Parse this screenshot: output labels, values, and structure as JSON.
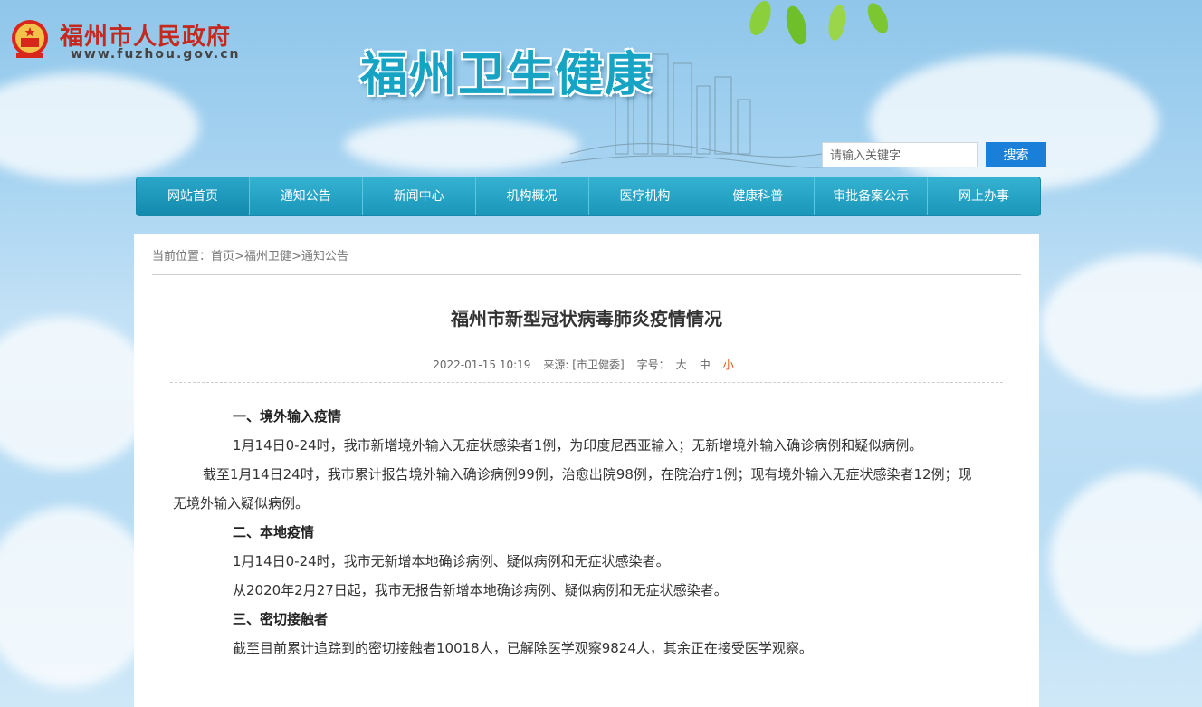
{
  "gov": {
    "name": "福州市人民政府",
    "url": "www.fuzhou.gov.cn"
  },
  "site_title": "福州卫生健康",
  "search": {
    "placeholder": "请输入关键字",
    "button_label": "搜索"
  },
  "nav": {
    "items": [
      {
        "label": "网站首页"
      },
      {
        "label": "通知公告"
      },
      {
        "label": "新闻中心"
      },
      {
        "label": "机构概况"
      },
      {
        "label": "医疗机构"
      },
      {
        "label": "健康科普"
      },
      {
        "label": "审批备案公示"
      },
      {
        "label": "网上办事"
      }
    ]
  },
  "breadcrumb": {
    "prefix": "当前位置：",
    "home": "首页",
    "sep1": ">",
    "level1": "福州卫健",
    "sep2": ">",
    "level2": "通知公告"
  },
  "article": {
    "title": "福州市新型冠状病毒肺炎疫情情况",
    "date": "2022-01-15 10:19",
    "source": "来源: [市卫健委]",
    "font_label": "字号：",
    "font_large": "大",
    "font_medium": "中",
    "font_small": "小",
    "sections": [
      {
        "heading": "一、境外输入疫情"
      },
      {
        "p": "1月14日0-24时，我市新增境外输入无症状感染者1例，为印度尼西亚输入；无新增境外输入确诊病例和疑似病例。"
      },
      {
        "p": "截至1月14日24时，我市累计报告境外输入确诊病例99例，治愈出院98例，在院治疗1例；现有境外输入无症状感染者12例；现无境外输入疑似病例。"
      },
      {
        "heading": "二、本地疫情"
      },
      {
        "p": "1月14日0-24时，我市无新增本地确诊病例、疑似病例和无症状感染者。"
      },
      {
        "p": "从2020年2月27日起，我市无报告新增本地确诊病例、疑似病例和无症状感染者。"
      },
      {
        "heading": "三、密切接触者"
      },
      {
        "p": "截至目前累计追踪到的密切接触者10018人，已解除医学观察9824人，其余正在接受医学观察。"
      }
    ]
  },
  "colors": {
    "nav_bg": "#1a96b8",
    "search_button": "#1a7fd8",
    "gov_name": "#c3291e",
    "site_title": "#16a3c4",
    "font_small_active": "#e0581c"
  }
}
